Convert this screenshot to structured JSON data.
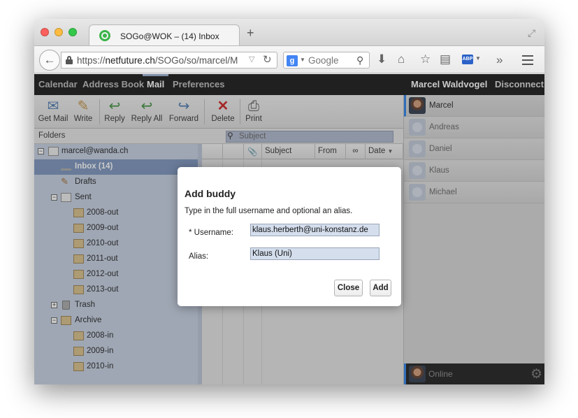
{
  "browser": {
    "tab_title": "SOGo@WOK – (14) Inbox",
    "url_prefix": "https://",
    "url_host": "netfuture.ch",
    "url_path": "/SOGo/so/marcel/Ma",
    "search_engine": "Google",
    "search_placeholder": "Google",
    "abp_label": "ABP"
  },
  "app_nav": {
    "items": [
      "Calendar",
      "Address Book",
      "Mail",
      "Preferences"
    ],
    "active": "Mail",
    "user_name": "Marcel Waldvogel",
    "disconnect_label": "Disconnect"
  },
  "toolbar": {
    "buttons": [
      {
        "label": "Get Mail",
        "icon": "get-mail-icon"
      },
      {
        "label": "Write",
        "icon": "pencil-icon"
      },
      {
        "label": "Reply",
        "icon": "reply-icon"
      },
      {
        "label": "Reply All",
        "icon": "reply-all-icon"
      },
      {
        "label": "Forward",
        "icon": "forward-icon"
      },
      {
        "label": "Delete",
        "icon": "delete-icon"
      },
      {
        "label": "Print",
        "icon": "printer-icon"
      }
    ]
  },
  "folders": {
    "header": "Folders",
    "account": "marcel@wanda.ch",
    "items": [
      {
        "name": "Inbox (14)",
        "selected": true
      },
      {
        "name": "Drafts"
      },
      {
        "name": "Sent"
      },
      {
        "name": "2008-out"
      },
      {
        "name": "2009-out"
      },
      {
        "name": "2010-out"
      },
      {
        "name": "2011-out"
      },
      {
        "name": "2012-out"
      },
      {
        "name": "2013-out"
      },
      {
        "name": "Trash"
      },
      {
        "name": "Archive"
      },
      {
        "name": "2008-in"
      },
      {
        "name": "2009-in"
      },
      {
        "name": "2010-in"
      }
    ]
  },
  "message_list": {
    "search_placeholder": "Subject",
    "columns": [
      "Subject",
      "From",
      "Date"
    ]
  },
  "buddies": {
    "list": [
      "Marcel",
      "Andreas",
      "Daniel",
      "Klaus",
      "Michael"
    ],
    "status": "Online"
  },
  "dialog": {
    "title": "Add buddy",
    "description": "Type in the full username and optional an alias.",
    "username_label": "* Username:",
    "username_value": "klaus.herberth@uni-konstanz.de",
    "alias_label": "Alias:",
    "alias_value": "Klaus (Uni)",
    "close_label": "Close",
    "add_label": "Add"
  },
  "colors": {
    "app_bar": "#161616",
    "folder_tree": "#c5d0e2",
    "selected_folder": "#7a93bd",
    "status_accent": "#2a82e8"
  }
}
